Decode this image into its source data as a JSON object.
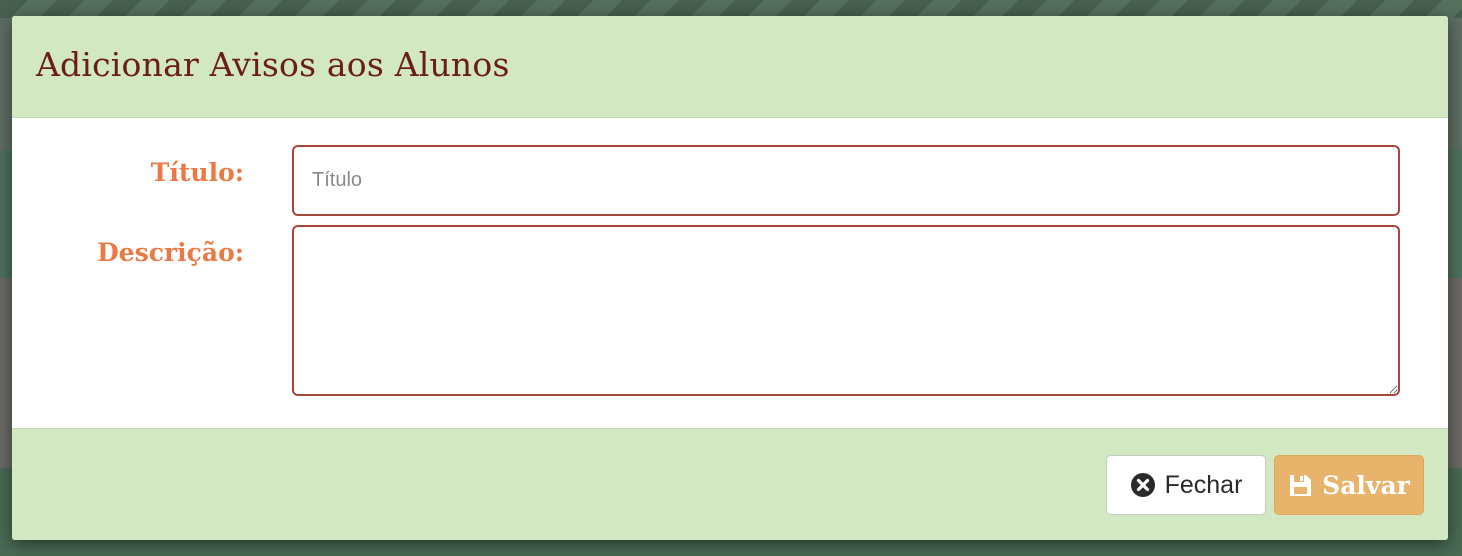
{
  "modal": {
    "title": "Adicionar Avisos aos Alunos",
    "form": {
      "titulo": {
        "label": "Título:",
        "placeholder": "Título",
        "value": ""
      },
      "descricao": {
        "label": "Descrição:",
        "value": ""
      }
    },
    "footer": {
      "close_label": "Fechar",
      "close_icon": "times-circle-icon",
      "save_label": "Salvar",
      "save_icon": "floppy-disk-icon"
    }
  },
  "colors": {
    "header_footer_bg": "#d1e8c2",
    "title_color": "#6b1e12",
    "label_color": "#ea7a45",
    "input_border": "#a6473c",
    "save_button_bg": "#e8b36b"
  }
}
